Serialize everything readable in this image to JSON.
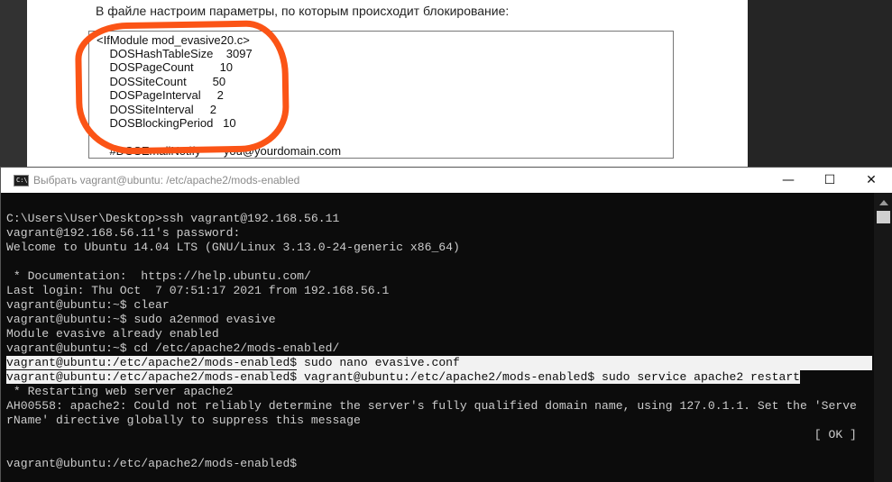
{
  "document": {
    "intro": "В файле настроим параметры, по которым происходит блокирование:",
    "code_lines": [
      "<IfModule mod_evasive20.c>",
      "    DOSHashTableSize    3097",
      "    DOSPageCount        10",
      "    DOSSiteCount        50",
      "    DOSPageInterval     2",
      "    DOSSiteInterval     2",
      "    DOSBlockingPeriod   10",
      "",
      "    #DOSEmailNotify       you@yourdomain.com"
    ],
    "highlight_color": "#fb5416"
  },
  "console": {
    "title": "Выбрать vagrant@ubuntu: /etc/apache2/mods-enabled",
    "icon_label": "C:\\",
    "controls": {
      "minimize": "—",
      "maximize": "☐",
      "close": "✕"
    },
    "lines": [
      "",
      "C:\\Users\\User\\Desktop>ssh vagrant@192.168.56.11",
      "vagrant@192.168.56.11's password:",
      "Welcome to Ubuntu 14.04 LTS (GNU/Linux 3.13.0-24-generic x86_64)",
      "",
      " * Documentation:  https://help.ubuntu.com/",
      "Last login: Thu Oct  7 07:51:17 2021 from 192.168.56.1",
      "vagrant@ubuntu:~$ clear",
      "vagrant@ubuntu:~$ sudo a2enmod evasive",
      "Module evasive already enabled",
      "vagrant@ubuntu:~$ cd /etc/apache2/mods-enabled/",
      "vagrant@ubuntu:/etc/apache2/mods-enabled$ sudo nano evasive.conf",
      "vagrant@ubuntu:/etc/apache2/mods-enabled$ vagrant@ubuntu:/etc/apache2/mods-enabled$ sudo service apache2 restart",
      " * Restarting web server apache2",
      "AH00558: apache2: Could not reliably determine the server's fully qualified domain name, using 127.0.1.1. Set the 'Serve",
      "rName' directive globally to suppress this message",
      "                                                                                                                  [ OK ]",
      "",
      "vagrant@ubuntu:/etc/apache2/mods-enabled$"
    ],
    "selected_lines": [
      11,
      12
    ],
    "colors": {
      "background": "#0c0c0c",
      "text": "#cccccc",
      "selection": "#f2f2f2"
    }
  }
}
